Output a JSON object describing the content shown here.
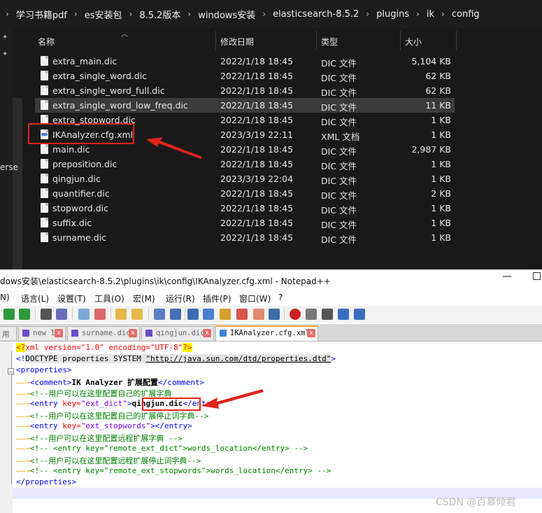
{
  "explorer": {
    "breadcrumb": [
      "学习书籍pdf",
      "es安装包",
      "8.5.2版本",
      "windows安装",
      "elasticsearch-8.5.2",
      "plugins",
      "ik",
      "config"
    ],
    "nav_partial": "erse",
    "columns": {
      "name": "名称",
      "modified": "修改日期",
      "type": "类型",
      "size": "大小"
    },
    "files": [
      {
        "name": "extra_main.dic",
        "date": "2022/1/18 18:45",
        "type": "DIC 文件",
        "size": "5,104 KB"
      },
      {
        "name": "extra_single_word.dic",
        "date": "2022/1/18 18:45",
        "type": "DIC 文件",
        "size": "62 KB"
      },
      {
        "name": "extra_single_word_full.dic",
        "date": "2022/1/18 18:45",
        "type": "DIC 文件",
        "size": "62 KB"
      },
      {
        "name": "extra_single_word_low_freq.dic",
        "date": "2022/1/18 18:45",
        "type": "DIC 文件",
        "size": "11 KB"
      },
      {
        "name": "extra_stopword.dic",
        "date": "2022/1/18 18:45",
        "type": "DIC 文件",
        "size": "1 KB"
      },
      {
        "name": "IKAnalyzer.cfg.xml",
        "date": "2023/3/19 22:11",
        "type": "XML 文档",
        "size": "1 KB"
      },
      {
        "name": "main.dic",
        "date": "2022/1/18 18:45",
        "type": "DIC 文件",
        "size": "2,987 KB"
      },
      {
        "name": "preposition.dic",
        "date": "2022/1/18 18:45",
        "type": "DIC 文件",
        "size": "1 KB"
      },
      {
        "name": "qingjun.dic",
        "date": "2023/3/19 22:04",
        "type": "DIC 文件",
        "size": "1 KB"
      },
      {
        "name": "quantifier.dic",
        "date": "2022/1/18 18:45",
        "type": "DIC 文件",
        "size": "2 KB"
      },
      {
        "name": "stopword.dic",
        "date": "2022/1/18 18:45",
        "type": "DIC 文件",
        "size": "1 KB"
      },
      {
        "name": "suffix.dic",
        "date": "2022/1/18 18:45",
        "type": "DIC 文件",
        "size": "1 KB"
      },
      {
        "name": "surname.dic",
        "date": "2022/1/18 18:45",
        "type": "DIC 文件",
        "size": "1 KB"
      }
    ],
    "selected_index": 3,
    "highlighted_index": 5
  },
  "notepad": {
    "title": "dows安装\\elasticsearch-8.5.2\\plugins\\ik\\config\\IKAnalyzer.cfg.xml - Notepad++",
    "window_min": "—",
    "menu": [
      "N)",
      "语言(L)",
      "设置(T)",
      "工具(O)",
      "宏(M)",
      "运行(R)",
      "插件(P)",
      "窗口(W)",
      "?"
    ],
    "tabs": [
      {
        "label": "用",
        "active": false
      },
      {
        "label": "new 1",
        "active": false
      },
      {
        "label": "surname.dic",
        "active": false
      },
      {
        "label": "qingjun.dic",
        "active": false
      },
      {
        "label": "IKAnalyzer.cfg.xml",
        "active": true
      }
    ],
    "tab_close": "x",
    "code": {
      "l1_open": "<?",
      "l1_text": "xml version=\"1.0\" encoding=\"UTF-8\"",
      "l1_close": "?>",
      "l2_open": "<!",
      "l2_text": "DOCTYPE properties SYSTEM ",
      "l2_url": "\"http://java.sun.com/dtd/properties.dtd\"",
      "l2_close": ">",
      "l3": "<properties>",
      "l4_open": "<comment>",
      "l4_text": "IK Analyzer 扩展配置",
      "l4_close": "</comment>",
      "l5": "<!--用户可以在这里配置自己的扩展字典",
      "l6_tag": "<entry ",
      "l6_attr": "key=",
      "l6_val": "\"ext_dict\"",
      "l6_gt": ">",
      "l6_text": "qingjun.dic",
      "l6_close": "</entry>",
      "l7": "<!--用户可以在这里配置自己的扩展停止词字典-->",
      "l8_tag": "<entry ",
      "l8_attr": "key=",
      "l8_val": "\"ext_stopwords\"",
      "l8_gt": ">",
      "l8_close": "</entry>",
      "l9": "<!--用户可以在这里配置远程扩展字典 -->",
      "l10": "<!-- <entry key=\"remote_ext_dict\">words_location</entry> -->",
      "l11": "<!--用户可以在这里配置远程扩展停止词字典-->",
      "l12": "<!-- <entry key=\"remote_ext_stopwords\">words_location</entry> -->",
      "l13": "</properties>"
    }
  },
  "watermark": "CSDN @百慕倾君"
}
